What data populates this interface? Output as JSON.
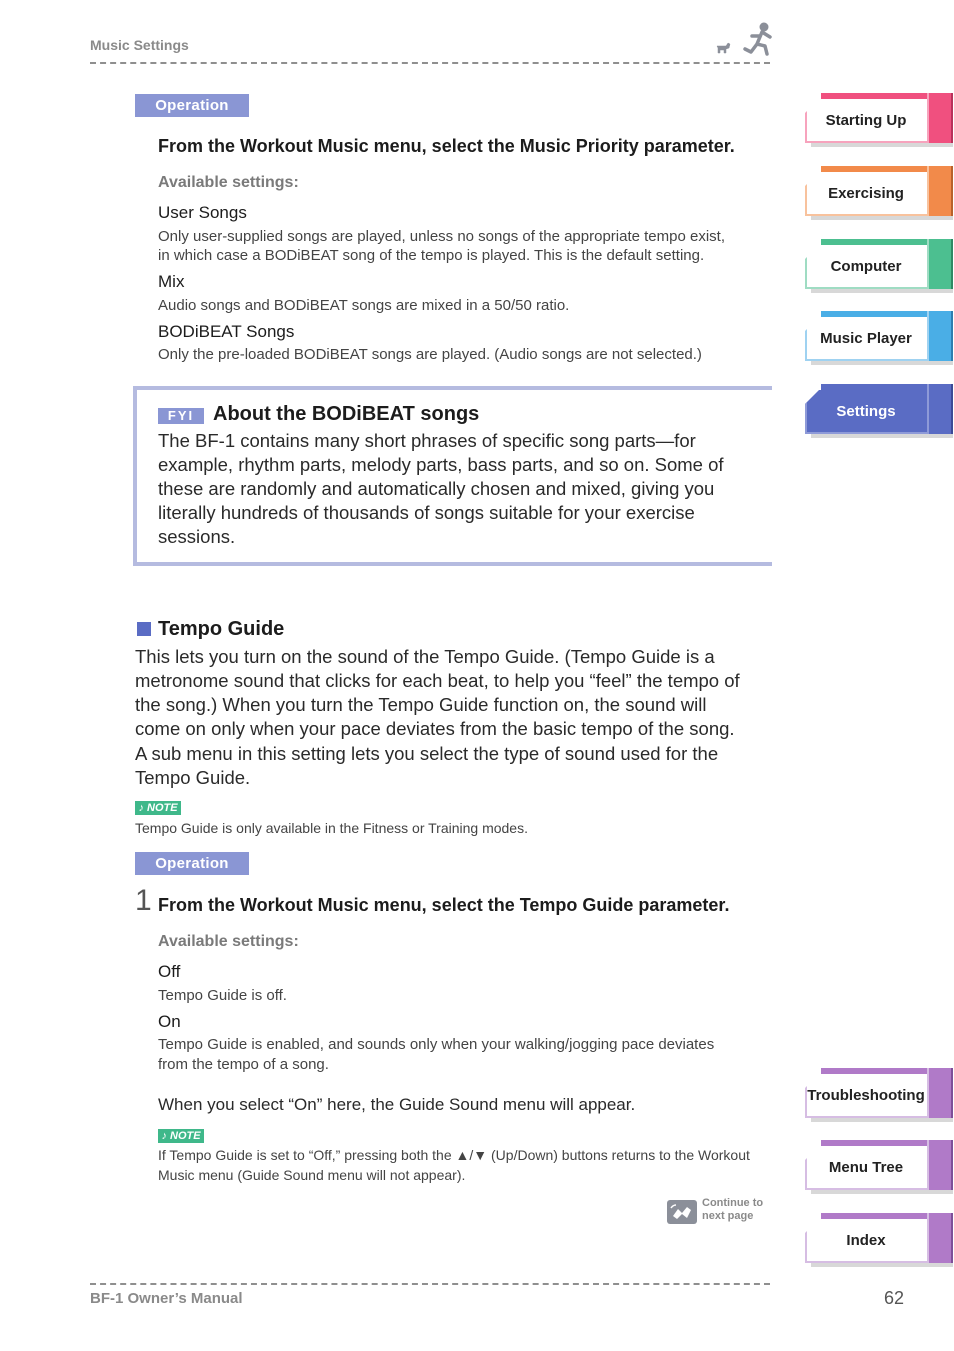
{
  "header": {
    "section_title": "Music Settings",
    "logo_icon": "runner-and-dog-icon"
  },
  "operation_label": "Operation",
  "music_priority": {
    "step_instruction": "From the Workout Music menu, select the Music Priority parameter.",
    "available_label": "Available settings:",
    "options": [
      {
        "name": "User Songs",
        "desc_lines": [
          "Only user-supplied songs are played, unless no songs of the appropriate tempo exist,",
          "in which case a BODiBEAT song of the tempo is played. This is the default setting."
        ]
      },
      {
        "name": "Mix",
        "desc_lines": [
          "Audio songs and BODiBEAT songs are mixed in a 50/50 ratio."
        ]
      },
      {
        "name": "BODiBEAT Songs",
        "desc_lines": [
          "Only the pre-loaded BODiBEAT songs are played. (Audio songs are not selected.)"
        ]
      }
    ]
  },
  "fyi": {
    "tag": "FYI",
    "title": "About the BODiBEAT songs",
    "lines": [
      "The BF-1 contains many short phrases of specific song parts—for",
      "example, rhythm parts, melody parts, bass parts, and so on. Some of",
      "these are randomly and automatically chosen and mixed, giving you",
      "literally hundreds of thousands of songs suitable for your exercise",
      "sessions."
    ]
  },
  "tempo_guide": {
    "title": "Tempo Guide",
    "lines": [
      "This lets you turn on the sound of the Tempo Guide. (Tempo Guide is a",
      "metronome sound that clicks for each beat, to help you “feel” the tempo of",
      "the song.) When you turn the Tempo Guide function on, the sound will",
      "come on only when your pace deviates from the basic tempo of the song.",
      "A sub menu in this setting lets you select the type of sound used for the",
      "Tempo Guide."
    ],
    "note_tag": "♪ NOTE",
    "note_text": "Tempo Guide is only available in the Fitness or Training modes.",
    "step_number": "1",
    "step_instruction": "From the Workout Music menu, select the Tempo Guide parameter.",
    "available_label": "Available settings:",
    "options": [
      {
        "name": "Off",
        "desc_lines": [
          "Tempo Guide is off."
        ]
      },
      {
        "name": "On",
        "desc_lines": [
          "Tempo Guide is enabled, and sounds only when your walking/jogging pace deviates",
          "from the tempo of a song."
        ]
      }
    ],
    "on_followup": "When you select “On” here, the Guide Sound menu will appear.",
    "note2_tag": "♪ NOTE",
    "note2_lines": [
      "If Tempo Guide is set to “Off,” pressing both the ▲/▼ (Up/Down) buttons returns to the Workout",
      "Music menu (Guide Sound menu will not appear)."
    ]
  },
  "continue": {
    "line1": "Continue to",
    "line2": "next page",
    "icon": "continue-arrow-icon"
  },
  "side_tabs": [
    {
      "label": "Starting Up",
      "color": "#f0507f",
      "dark": "#b8325a",
      "light": "#f7a3bd",
      "active": false
    },
    {
      "label": "Exercising",
      "color": "#f28a4a",
      "dark": "#b8622c",
      "light": "#f8c29d",
      "active": false
    },
    {
      "label": "Computer",
      "color": "#4cbf90",
      "dark": "#2e8a64",
      "light": "#9fdcc3",
      "active": false
    },
    {
      "label": "Music Player",
      "color": "#4aaee6",
      "dark": "#2c7eb0",
      "light": "#9fd2f1",
      "active": false
    },
    {
      "label": "Settings",
      "color": "#5a6cc4",
      "dark": "#3c4a96",
      "light": "#8e9ad8",
      "active": true
    },
    {
      "label": "Troubleshooting",
      "color": "#b07ac8",
      "dark": "#7e4f98",
      "light": "#d6bde3",
      "active": false
    },
    {
      "label": "Menu Tree",
      "color": "#b07ac8",
      "dark": "#7e4f98",
      "light": "#d6bde3",
      "active": false
    },
    {
      "label": "Index",
      "color": "#b07ac8",
      "dark": "#7e4f98",
      "light": "#d6bde3",
      "active": false
    }
  ],
  "footer": {
    "manual_title": "BF-1 Owner’s Manual",
    "page_number": "62"
  }
}
